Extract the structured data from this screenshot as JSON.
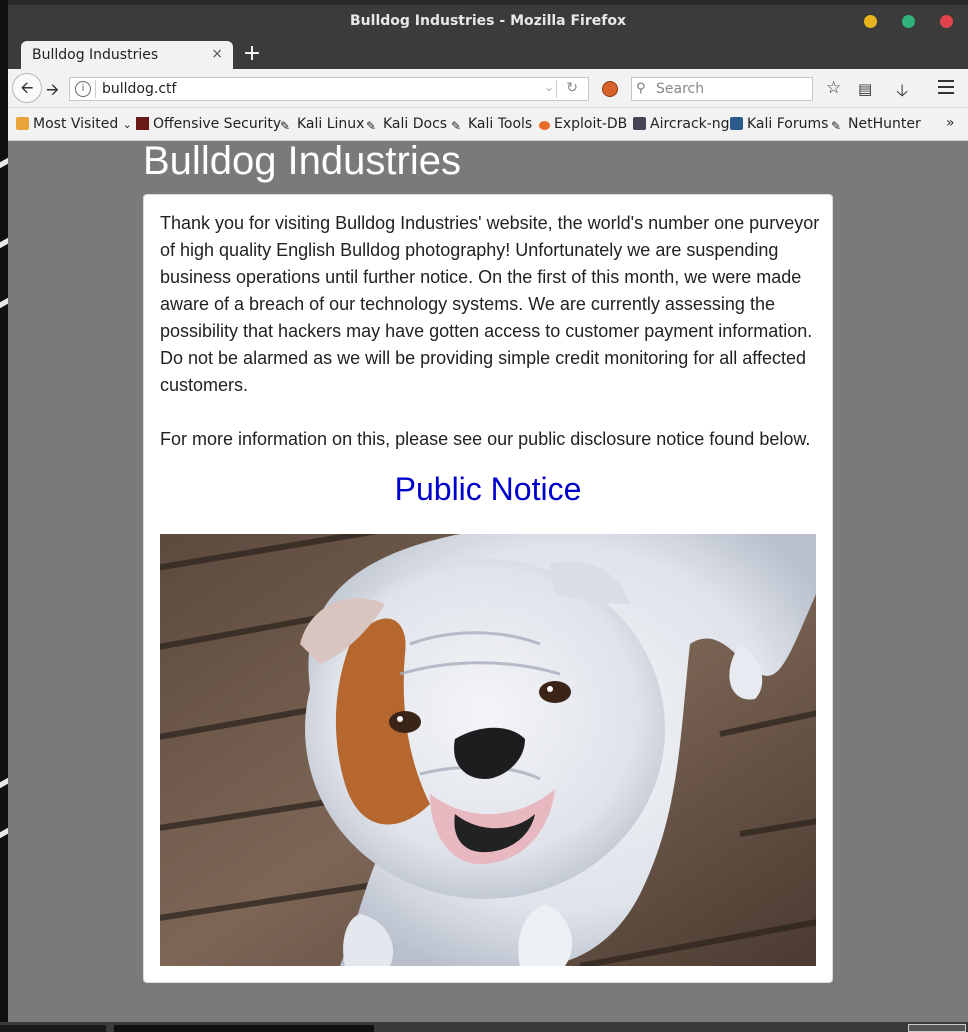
{
  "window": {
    "title": "Bulldog Industries - Mozilla Firefox",
    "buttons": {
      "minimize": "#e6b41e",
      "maximize": "#2fb37a",
      "close": "#e2434d"
    }
  },
  "tab": {
    "label": "Bulldog Industries",
    "close_glyph": "×",
    "new_tab_glyph": "+"
  },
  "navbar": {
    "url": "bulldog.ctf",
    "search_placeholder": "Search",
    "icons": [
      "back-arrow-icon",
      "forward-arrow-icon",
      "info-icon",
      "reload-icon",
      "bookmark-star-icon",
      "reading-list-icon",
      "download-icon",
      "hamburger-menu-icon"
    ]
  },
  "bookmarks": {
    "items": [
      {
        "label": "Most Visited",
        "icon": "folder-icon"
      },
      {
        "label": "Offensive Security",
        "icon": "offsec-icon"
      },
      {
        "label": "Kali Linux",
        "icon": "kali-dragon-icon"
      },
      {
        "label": "Kali Docs",
        "icon": "kali-dragon-icon"
      },
      {
        "label": "Kali Tools",
        "icon": "kali-dragon-icon"
      },
      {
        "label": "Exploit-DB",
        "icon": "exploitdb-icon"
      },
      {
        "label": "Aircrack-ng",
        "icon": "aircrack-icon"
      },
      {
        "label": "Kali Forums",
        "icon": "kali-forums-icon"
      },
      {
        "label": "NetHunter",
        "icon": "kali-dragon-icon"
      }
    ],
    "overflow_glyph": "»"
  },
  "page": {
    "heading": "Bulldog Industries",
    "paragraph1": "Thank you for visiting Bulldog Industries' website, the world's number one purveyor of high quality English Bulldog photography! Unfortunately we are suspending business operations until further notice. On the first of this month, we were made aware of a breach of our technology systems. We are currently assessing the possibility that hackers may have gotten access to customer payment information. Do not be alarmed as we will be providing simple credit monitoring for all affected customers.",
    "paragraph2": "For more information on this, please see our public disclosure notice found below.",
    "link_text": "Public Notice",
    "link_color": "#0000cc"
  }
}
